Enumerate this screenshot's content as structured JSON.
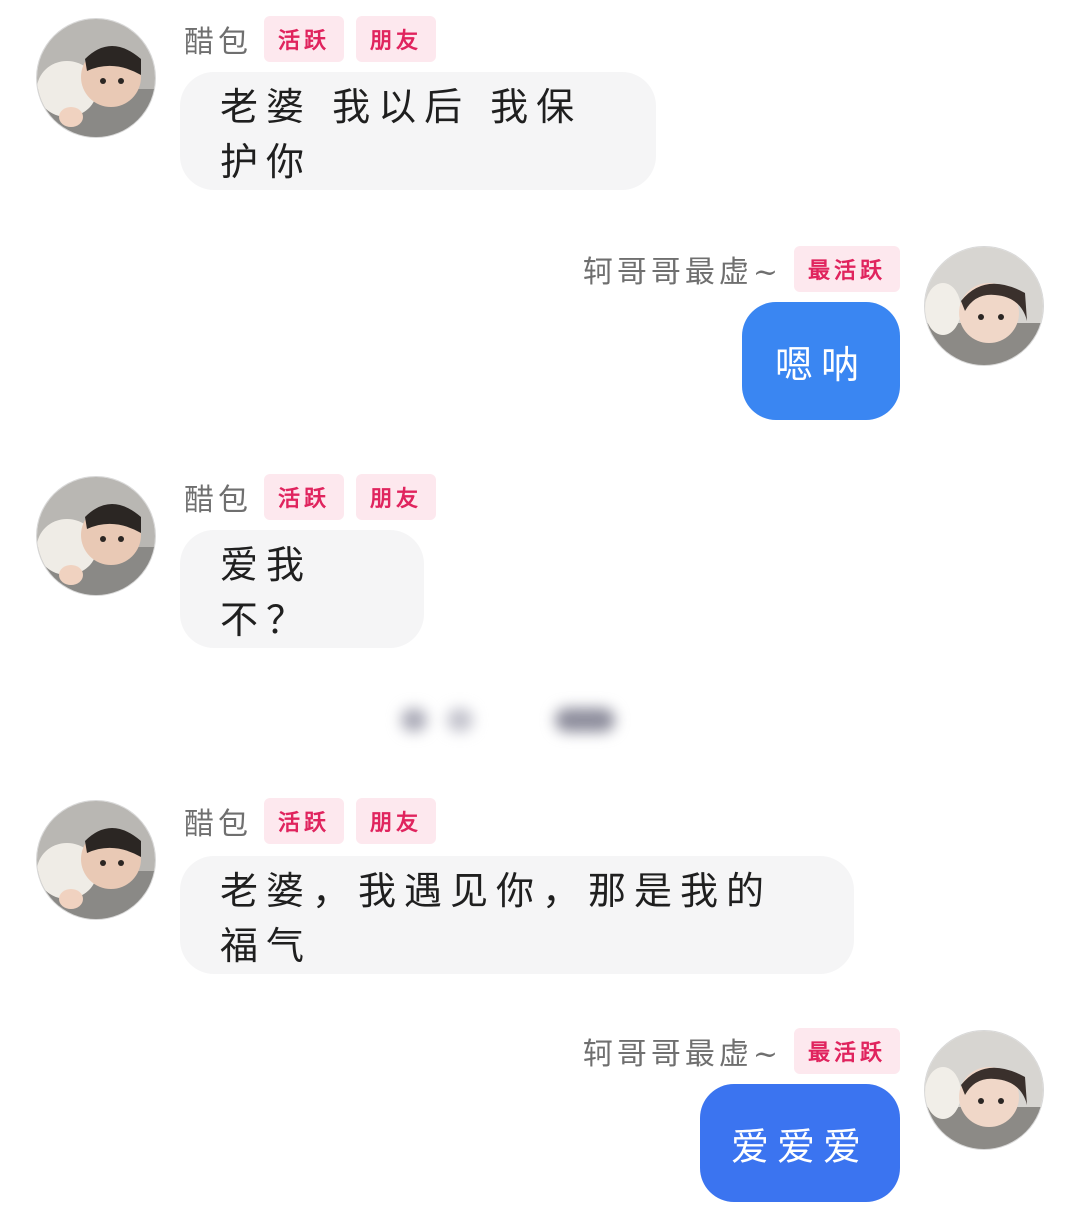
{
  "messages": [
    {
      "side": "left",
      "sender": "醋包",
      "badges": [
        "活跃",
        "朋友"
      ],
      "text": "老婆 我以后 我保护你",
      "avatar_icon": "baby-photo-avatar"
    },
    {
      "side": "right",
      "sender": "轲哥哥最虚~",
      "badges": [
        "最活跃"
      ],
      "text": "嗯呐",
      "avatar_icon": "girl-photo-avatar",
      "bubble_color": "#3a86f2"
    },
    {
      "side": "left",
      "sender": "醋包",
      "badges": [
        "活跃",
        "朋友"
      ],
      "text": "爱我不？",
      "avatar_icon": "baby-photo-avatar"
    },
    {
      "side": "left",
      "sender": "醋包",
      "badges": [
        "活跃",
        "朋友"
      ],
      "text": "老婆，我遇见你，那是我的福气",
      "avatar_icon": "baby-photo-avatar"
    },
    {
      "side": "right",
      "sender": "轲哥哥最虚~",
      "badges": [
        "最活跃"
      ],
      "text": "爱爱爱",
      "avatar_icon": "girl-photo-avatar",
      "bubble_color": "#3b74f0"
    }
  ],
  "colors": {
    "incoming_bubble": "#f5f5f6",
    "badge_bg": "#fde8ee",
    "badge_text": "#e0245e",
    "sender_name": "#6f6f6f"
  }
}
